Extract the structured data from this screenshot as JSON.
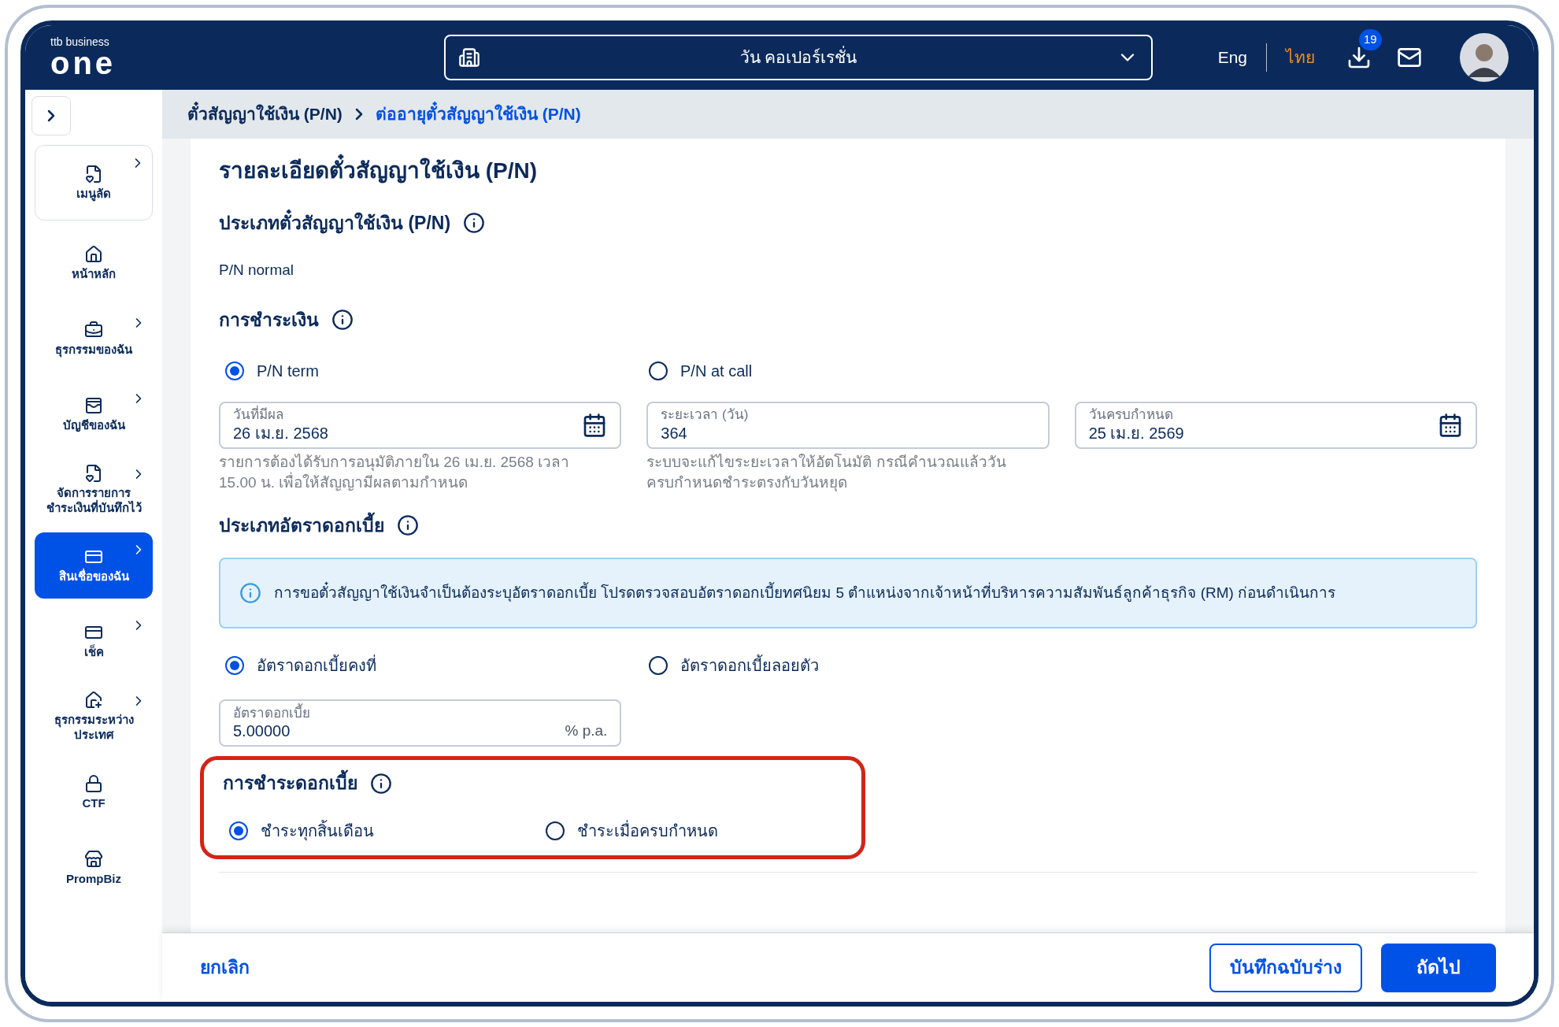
{
  "header": {
    "logo_top": "ttb business",
    "logo_main": "one",
    "company": "วัน คอเปอร์เรชั่น",
    "languages": [
      {
        "label": "Eng",
        "selected": false
      },
      {
        "label": "ไทย",
        "selected": true
      }
    ],
    "download_badge": "19"
  },
  "sidebar": {
    "items": [
      {
        "label": "เมนูลัด",
        "kind": "shortcut",
        "selected": false
      },
      {
        "label": "หน้าหลัก",
        "kind": "link",
        "selected": false
      },
      {
        "label": "ธุรกรรมของฉัน",
        "kind": "submenu",
        "selected": false
      },
      {
        "label": "บัญชีของฉัน",
        "kind": "submenu",
        "selected": false
      },
      {
        "label": "จัดการรายการชำระเงินที่บันทึกไว้",
        "kind": "submenu",
        "selected": false
      },
      {
        "label": "สินเชื่อของฉัน",
        "kind": "submenu",
        "selected": true
      },
      {
        "label": "เช็ค",
        "kind": "submenu",
        "selected": false
      },
      {
        "label": "ธุรกรรมระหว่างประเทศ",
        "kind": "submenu",
        "selected": false
      },
      {
        "label": "CTF",
        "kind": "link",
        "selected": false
      },
      {
        "label": "PrompBiz",
        "kind": "link",
        "selected": false
      }
    ]
  },
  "breadcrumb": [
    "ตั๋วสัญญาใช้เงิน (P/N)",
    "ต่ออายุตั๋วสัญญาใช้เงิน (P/N)"
  ],
  "title": "รายละเอียดตั๋วสัญญาใช้เงิน (P/N)",
  "pn_type": {
    "heading": "ประเภทตั๋วสัญญาใช้เงิน (P/N)",
    "value": "P/N normal"
  },
  "payment": {
    "heading": "การชำระเงิน",
    "options": [
      {
        "label": "P/N term",
        "selected": true
      },
      {
        "label": "P/N at call",
        "selected": false
      }
    ],
    "fields": [
      {
        "label": "วันที่มีผล",
        "value": "26 เม.ย. 2568",
        "calendar": true,
        "help": "รายการต้องได้รับการอนุมัติภายใน 26 เม.ย. 2568 เวลา 15.00 น. เพื่อให้สัญญามีผลตามกำหนด"
      },
      {
        "label": "ระยะเวลา (วัน)",
        "value": "364",
        "calendar": false,
        "help": "ระบบจะแก้ไขระยะเวลาให้อัตโนมัติ กรณีคำนวณแล้ววันครบกำหนดชำระตรงกับวันหยุด"
      },
      {
        "label": "วันครบกำหนด",
        "value": "25 เม.ย. 2569",
        "calendar": true
      }
    ]
  },
  "rate_type": {
    "heading": "ประเภทอัตราดอกเบี้ย",
    "notice": "การขอตั๋วสัญญาใช้เงินจำเป็นต้องระบุอัตราดอกเบี้ย โปรดตรวจสอบอัตราดอกเบี้ยทศนิยม 5 ตำแหน่งจากเจ้าหน้าที่บริหารความสัมพันธ์ลูกค้าธุรกิจ (RM) ก่อนดำเนินการ",
    "options": [
      {
        "label": "อัตราดอกเบี้ยคงที่",
        "selected": true
      },
      {
        "label": "อัตราดอกเบี้ยลอยตัว",
        "selected": false
      }
    ],
    "field": {
      "label": "อัตราดอกเบี้ย",
      "value": "5.00000",
      "suffix": "% p.a."
    }
  },
  "interest_payment": {
    "heading": "การชำระดอกเบี้ย",
    "highlighted": true,
    "options": [
      {
        "label": "ชำระทุกสิ้นเดือน",
        "selected": true
      },
      {
        "label": "ชำระเมื่อครบกำหนด",
        "selected": false
      }
    ]
  },
  "footer": {
    "cancel": "ยกเลิก",
    "save_draft": "บันทึกฉบับร่าง",
    "next": "ถัดไป"
  }
}
